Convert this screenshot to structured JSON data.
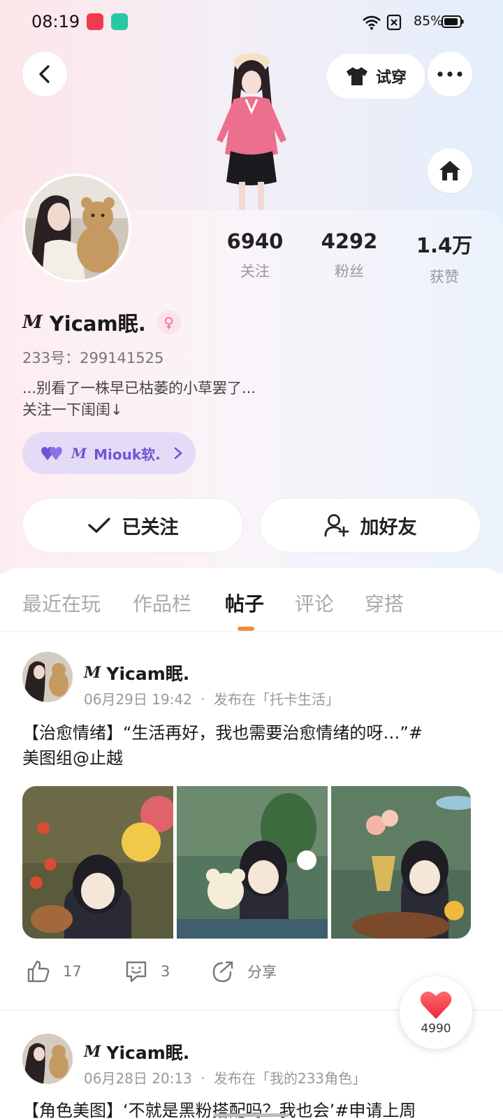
{
  "status_bar": {
    "time": "08:19",
    "battery": "85%"
  },
  "header": {
    "try_on_label": "试穿"
  },
  "stats": [
    {
      "value": "6940",
      "label": "关注"
    },
    {
      "value": "4292",
      "label": "粉丝"
    },
    {
      "value": "1.4万",
      "label": "获赞"
    }
  ],
  "profile": {
    "script_prefix": "M",
    "name": "Yicam眠.",
    "uid": "233号：299141525",
    "bio_line1": "...别看了一株早已枯萎的小草罢了...",
    "bio_line2": "关注一下闺闺↓",
    "cp_script": "M",
    "cp_name": "Miouk软.",
    "gender_icon": "female-icon"
  },
  "actions": {
    "followed_label": "已关注",
    "add_friend_label": "加好友"
  },
  "tabs": [
    {
      "label": "最近在玩"
    },
    {
      "label": "作品栏"
    },
    {
      "label": "帖子"
    },
    {
      "label": "评论"
    },
    {
      "label": "穿搭"
    }
  ],
  "active_tab": "帖子",
  "posts": [
    {
      "author_script": "M",
      "author": "Yicam眠.",
      "time": "06月29日 19:42",
      "published_in": "发布在「托卡生活」",
      "text_line1": "【治愈情绪】“生活再好，我也需要治愈情绪的呀…”#",
      "text_line2": "美图组@止越",
      "likes": "17",
      "comments": "3",
      "share_label": "分享"
    },
    {
      "author_script": "M",
      "author": "Yicam眠.",
      "time": "06月28日 20:13",
      "published_in": "发布在「我的233角色」",
      "text_line1": "【角色美图】‘不就是黑粉搭配吗？我也会’#申请上周"
    }
  ],
  "floating_like": {
    "count": "4990"
  },
  "colors": {
    "accent_orange": "#f48a3a",
    "cp_purple": "#6f55d3",
    "like_red": "#f0334a"
  }
}
